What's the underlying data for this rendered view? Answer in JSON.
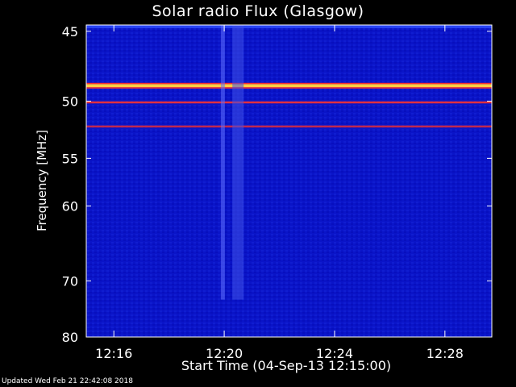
{
  "chart_data": {
    "type": "heatmap",
    "title": "Solar radio Flux (Glasgow)",
    "xlabel": "Start Time (04-Sep-13 12:15:00)",
    "ylabel": "Frequency [MHz]",
    "x_ticks": [
      "12:16",
      "12:20",
      "12:24",
      "12:28"
    ],
    "x_tick_minutes": [
      1,
      5,
      9,
      13
    ],
    "xlim_minutes": [
      0,
      14.7
    ],
    "y_ticks": [
      45,
      50,
      55,
      60,
      70,
      80
    ],
    "ylim": [
      44.6,
      80
    ],
    "yscale": "reciprocal",
    "colormap": "blue-red-yellow",
    "background_color": "#0a14c8",
    "features": [
      {
        "kind": "horizontal-band",
        "freq_mhz": 48.8,
        "intensity": "high",
        "color": "#ffd040"
      },
      {
        "kind": "horizontal-band",
        "freq_mhz": 50.1,
        "intensity": "medium",
        "color": "#e03040"
      },
      {
        "kind": "horizontal-band",
        "freq_mhz": 52.1,
        "intensity": "medium",
        "color": "#c02850"
      },
      {
        "kind": "vertical-burst",
        "time_minutes": 4.95,
        "intensity": "medium",
        "color": "#6070ff"
      },
      {
        "kind": "vertical-burst",
        "time_minutes": 5.5,
        "intensity": "low",
        "color": "#4050e8"
      }
    ]
  },
  "footer": "Updated Wed Feb 21 22:42:08 2018"
}
